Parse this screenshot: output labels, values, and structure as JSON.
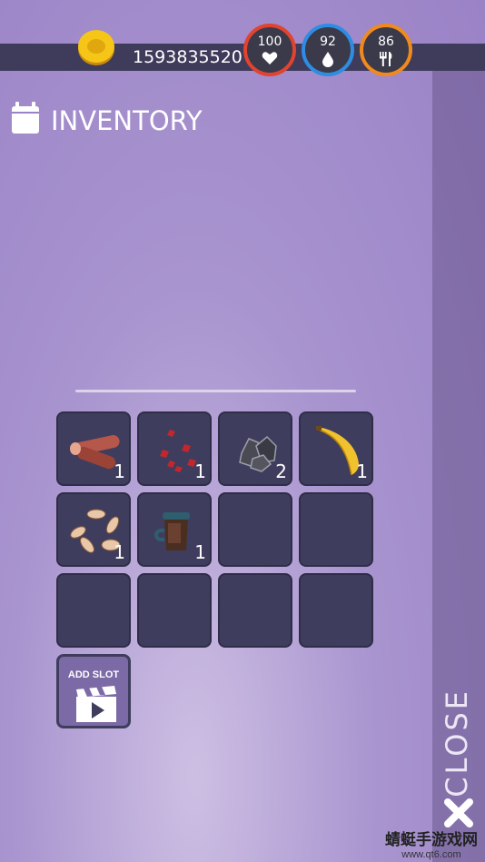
{
  "header": {
    "coins": "1593835520",
    "stats": [
      {
        "id": "health",
        "value": "100",
        "icon": "heart-icon",
        "color": "#e2432e"
      },
      {
        "id": "water",
        "value": "92",
        "icon": "water-drop-icon",
        "color": "#2e8de2"
      },
      {
        "id": "food",
        "value": "86",
        "icon": "fork-knife-icon",
        "color": "#f08a1c"
      }
    ]
  },
  "panel": {
    "title": "INVENTORY"
  },
  "inventory": {
    "slots": [
      {
        "item": "wood-logs",
        "qty": "1"
      },
      {
        "item": "red-berries",
        "qty": "1"
      },
      {
        "item": "coal-rocks",
        "qty": "2"
      },
      {
        "item": "banana",
        "qty": "1"
      },
      {
        "item": "seeds",
        "qty": "1"
      },
      {
        "item": "coffee-cup",
        "qty": "1"
      },
      {
        "item": "",
        "qty": ""
      },
      {
        "item": "",
        "qty": ""
      },
      {
        "item": "",
        "qty": ""
      },
      {
        "item": "",
        "qty": ""
      },
      {
        "item": "",
        "qty": ""
      },
      {
        "item": "",
        "qty": ""
      }
    ],
    "add_slot_label": "ADD SLOT"
  },
  "close_label": "CLOSE",
  "watermark": {
    "name": "蜻蜓手游戏网",
    "url": "www.qt6.com"
  }
}
